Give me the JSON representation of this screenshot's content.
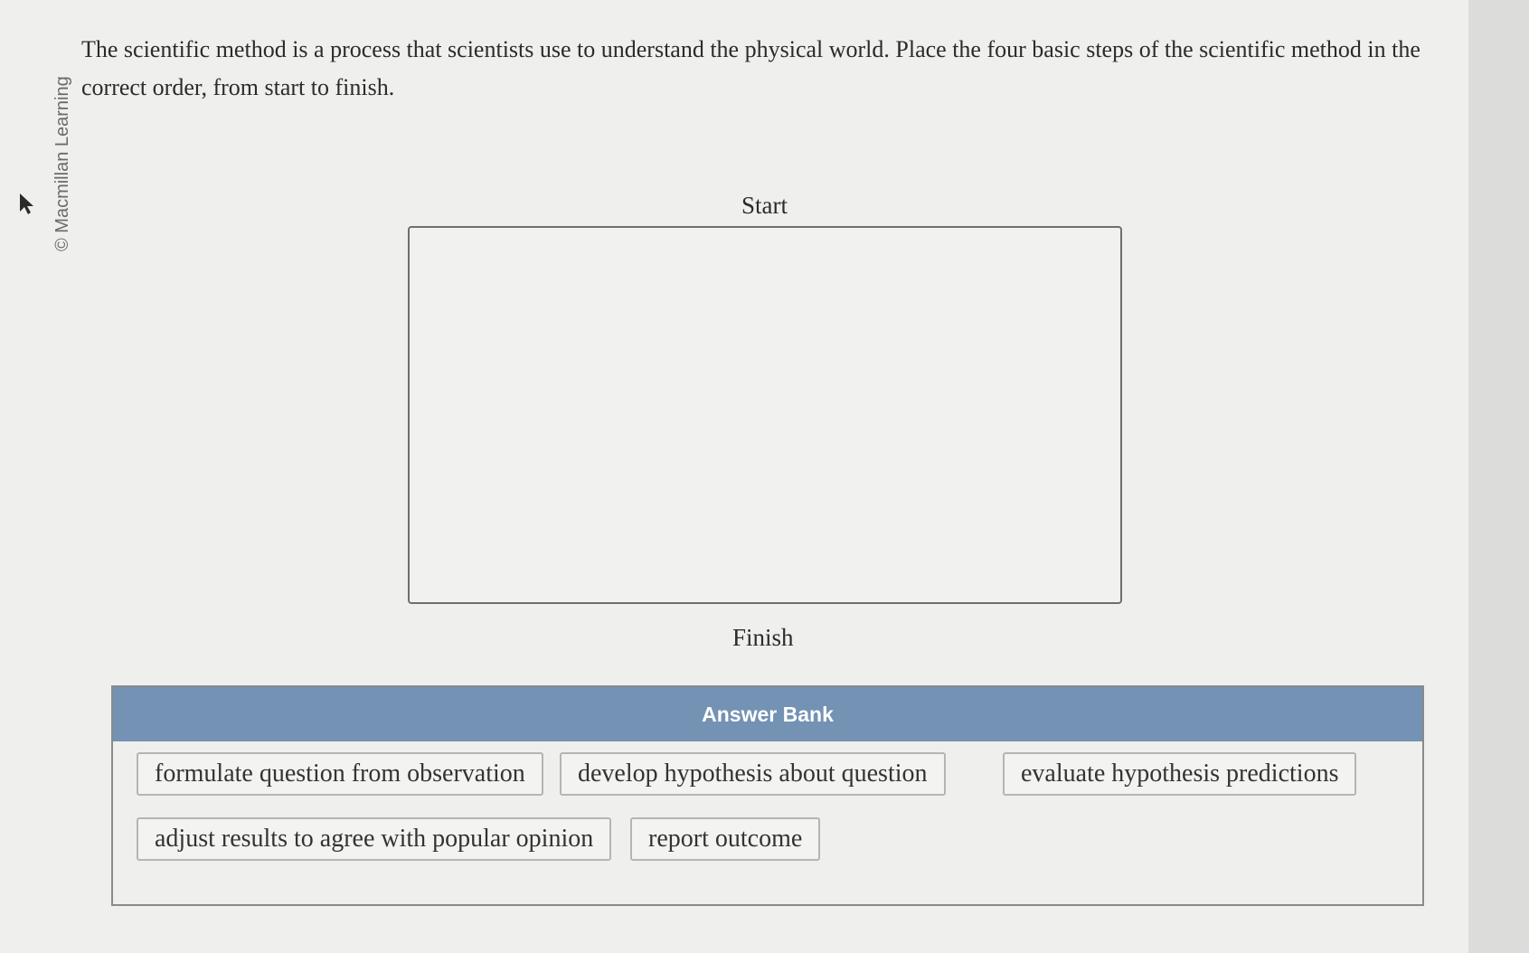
{
  "copyright": "© Macmillan Learning",
  "question": {
    "text": "The scientific method is a process that scientists use to understand the physical world. Place the four basic steps of the scientific method in the correct order, from start to finish."
  },
  "sequence": {
    "start_label": "Start",
    "finish_label": "Finish"
  },
  "answer_bank": {
    "title": "Answer Bank",
    "items": [
      {
        "label": "formulate question from observation"
      },
      {
        "label": "develop hypothesis about question"
      },
      {
        "label": "evaluate hypothesis predictions"
      },
      {
        "label": "adjust results to agree with popular opinion"
      },
      {
        "label": "report outcome"
      }
    ]
  },
  "icons": {
    "cursor": "cursor-arrow-icon"
  }
}
